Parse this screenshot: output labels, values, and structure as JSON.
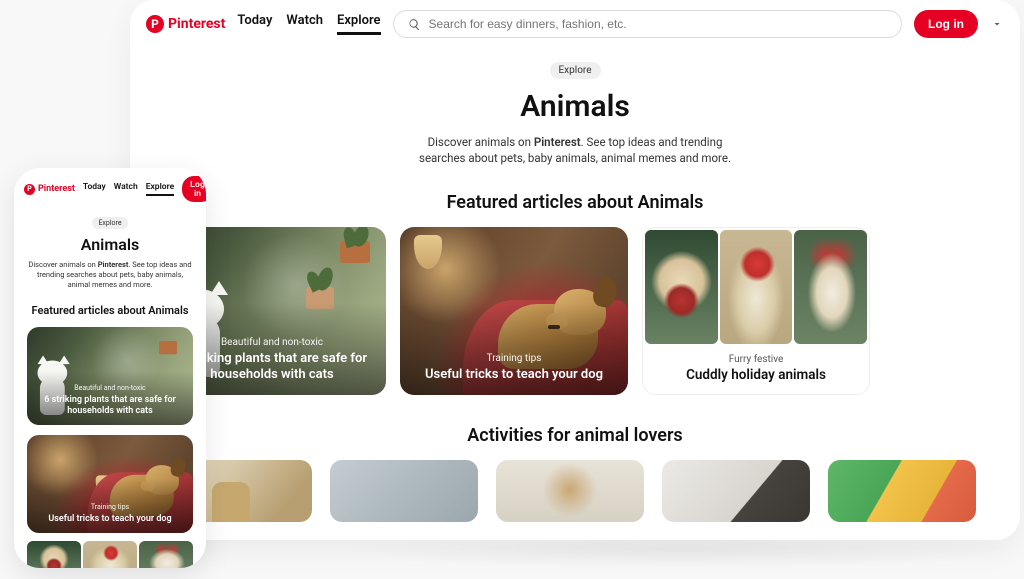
{
  "brand": {
    "name": "Pinterest",
    "glyph": "P",
    "color": "#e60023"
  },
  "nav": {
    "items": [
      "Today",
      "Watch",
      "Explore"
    ],
    "active": "Explore"
  },
  "search": {
    "placeholder": "Search for easy dinners, fashion, etc."
  },
  "auth": {
    "login_label": "Log in"
  },
  "page": {
    "crumb": "Explore",
    "title": "Animals",
    "desc_pre": "Discover animals on ",
    "desc_bold": "Pinterest",
    "desc_post": ". See top ideas and trending searches about pets, baby animals, animal memes and more."
  },
  "sections": {
    "featured_title": "Featured articles about Animals",
    "activities_title": "Activities for animal lovers"
  },
  "featured": [
    {
      "kicker": "Beautiful and non-toxic",
      "title": "6 striking plants that are safe for households with cats"
    },
    {
      "kicker": "Training tips",
      "title": "Useful tricks to teach your dog"
    },
    {
      "kicker": "Furry festive",
      "title": "Cuddly holiday animals"
    }
  ]
}
